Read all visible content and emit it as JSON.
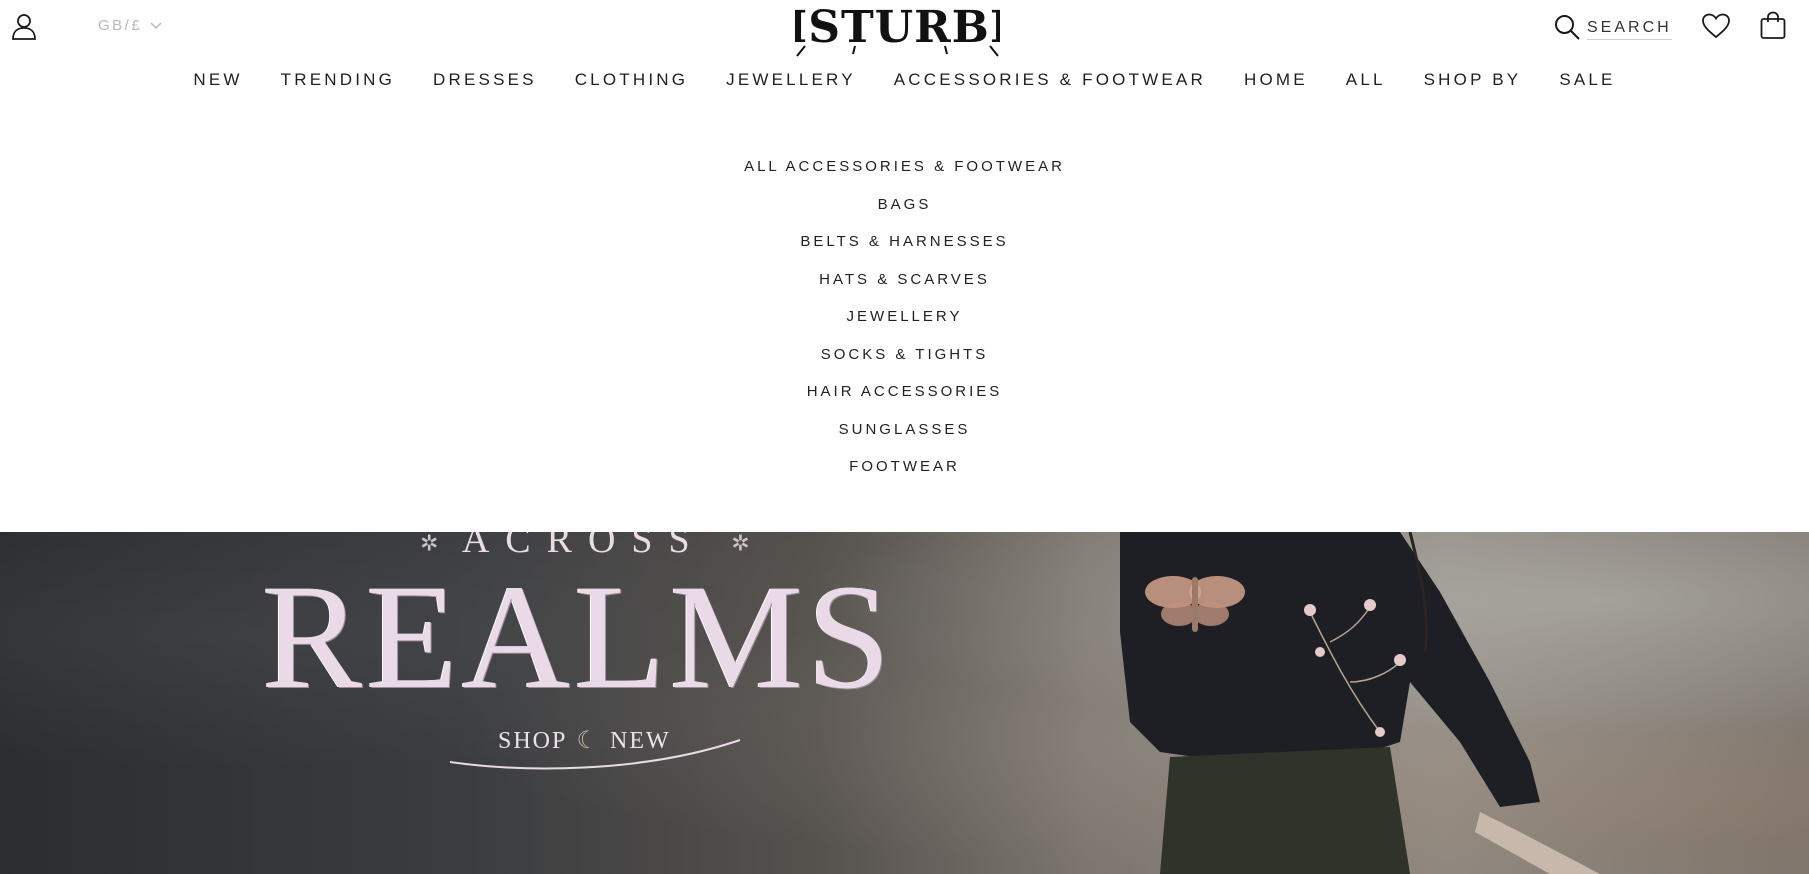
{
  "header": {
    "currency": "GB/£",
    "logo_text": "DISTURBIA",
    "search_label": "SEARCH"
  },
  "nav": {
    "items": [
      {
        "label": "NEW"
      },
      {
        "label": "TRENDING"
      },
      {
        "label": "DRESSES"
      },
      {
        "label": "CLOTHING"
      },
      {
        "label": "JEWELLERY"
      },
      {
        "label": "ACCESSORIES & FOOTWEAR"
      },
      {
        "label": "HOME"
      },
      {
        "label": "ALL"
      },
      {
        "label": "SHOP BY"
      },
      {
        "label": "SALE"
      }
    ],
    "active": "ACCESSORIES & FOOTWEAR"
  },
  "dropdown": {
    "items": [
      {
        "label": "ALL ACCESSORIES & FOOTWEAR"
      },
      {
        "label": "BAGS"
      },
      {
        "label": "BELTS & HARNESSES"
      },
      {
        "label": "HATS & SCARVES"
      },
      {
        "label": "JEWELLERY"
      },
      {
        "label": "SOCKS & TIGHTS"
      },
      {
        "label": "HAIR ACCESSORIES"
      },
      {
        "label": "SUNGLASSES"
      },
      {
        "label": "FOOTWEAR"
      }
    ]
  },
  "hero": {
    "across": "ACROSS",
    "title": "REALMS",
    "cta_left": "SHOP",
    "cta_right": "NEW"
  },
  "icons": {
    "account": "account-icon",
    "currency_chevron": "chevron-down-icon",
    "search": "search-icon",
    "wishlist": "heart-icon",
    "bag": "shopping-bag-icon"
  },
  "colors": {
    "text": "#1f1f1f",
    "muted": "#b9b9b9",
    "hero_text": "#ead9e7",
    "background": "#ffffff"
  }
}
